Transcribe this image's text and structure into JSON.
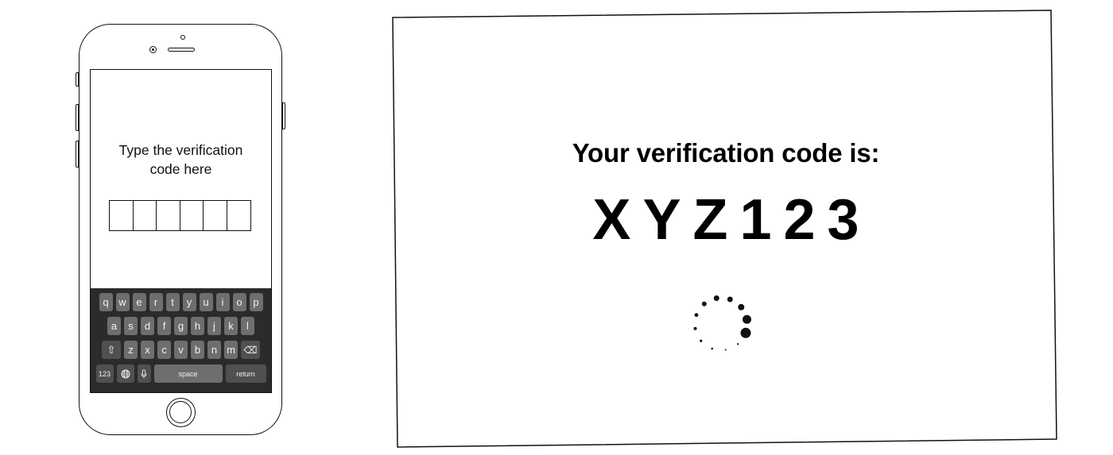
{
  "phone": {
    "prompt_line1": "Type the verification",
    "prompt_line2": "code here",
    "code_box_count": 6,
    "keyboard": {
      "row1": [
        "q",
        "w",
        "e",
        "r",
        "t",
        "y",
        "u",
        "i",
        "o",
        "p"
      ],
      "row2": [
        "a",
        "s",
        "d",
        "f",
        "g",
        "h",
        "j",
        "k",
        "l"
      ],
      "row3": [
        "z",
        "x",
        "c",
        "v",
        "b",
        "n",
        "m"
      ],
      "shift_icon": "⇧",
      "delete_icon": "⌫",
      "numbers_label": "123",
      "globe_icon": "🌐",
      "mic_icon": "🎙",
      "space_label": "space",
      "return_label": "return"
    }
  },
  "display": {
    "title": "Your verification code is:",
    "code": "XYZ123"
  },
  "colors": {
    "keyboard_bg": "#2b2b2b",
    "key_bg": "#6e6e6e",
    "key_func_bg": "#505050",
    "ink": "#111111"
  }
}
